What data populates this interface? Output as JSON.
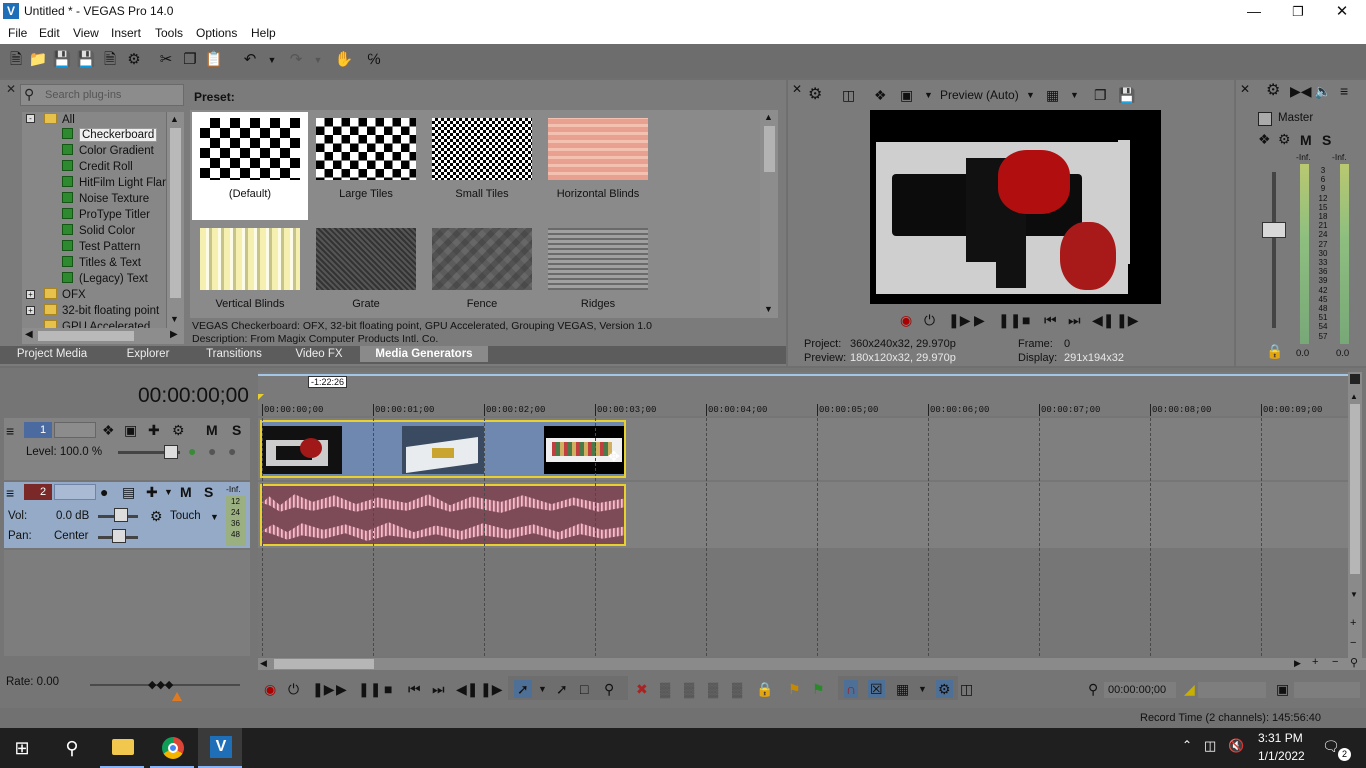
{
  "window": {
    "title": "Untitled * - VEGAS Pro 14.0"
  },
  "menu": [
    "File",
    "Edit",
    "View",
    "Insert",
    "Tools",
    "Options",
    "Help"
  ],
  "plugins": {
    "search_placeholder": "Search plug-ins",
    "tree": [
      {
        "label": "All",
        "type": "folder"
      },
      {
        "label": "Checkerboard",
        "type": "gen",
        "selected": true
      },
      {
        "label": "Color Gradient",
        "type": "gen"
      },
      {
        "label": "Credit Roll",
        "type": "gen"
      },
      {
        "label": "HitFilm Light Flares",
        "type": "gen"
      },
      {
        "label": "Noise Texture",
        "type": "gen"
      },
      {
        "label": "ProType Titler",
        "type": "gen"
      },
      {
        "label": "Solid Color",
        "type": "gen"
      },
      {
        "label": "Test Pattern",
        "type": "gen"
      },
      {
        "label": "Titles & Text",
        "type": "gen"
      },
      {
        "label": "(Legacy) Text",
        "type": "gen"
      },
      {
        "label": "OFX",
        "type": "folder"
      },
      {
        "label": "32-bit floating point",
        "type": "folder"
      },
      {
        "label": "GPU Accelerated",
        "type": "folder"
      }
    ],
    "preset_label": "Preset:",
    "presets": [
      "(Default)",
      "Large Tiles",
      "Small Tiles",
      "Horizontal Blinds",
      "Vertical Blinds",
      "Grate",
      "Fence",
      "Ridges"
    ],
    "info_line1": "VEGAS Checkerboard: OFX, 32-bit floating point, GPU Accelerated, Grouping VEGAS, Version 1.0",
    "info_line2": "Description: From Magix Computer Products Intl. Co.",
    "tabs": [
      "Project Media",
      "Explorer",
      "Transitions",
      "Video FX",
      "Media Generators"
    ]
  },
  "preview": {
    "mode": "Preview (Auto)",
    "project_label": "Project:",
    "project_value": "360x240x32, 29.970p",
    "preview_label": "Preview:",
    "preview_value": "180x120x32, 29.970p",
    "frame_label": "Frame:",
    "frame_value": "0",
    "display_label": "Display:",
    "display_value": "291x194x32"
  },
  "mixer": {
    "master_label": "Master",
    "m": "M",
    "s": "S",
    "inf_left": "-Inf.",
    "inf_right": "-Inf.",
    "scale": [
      "3",
      "6",
      "9",
      "12",
      "15",
      "18",
      "21",
      "24",
      "27",
      "30",
      "33",
      "36",
      "39",
      "42",
      "45",
      "48",
      "51",
      "54",
      "57"
    ],
    "bottom_left": "0.0",
    "bottom_right": "0.0"
  },
  "timeline": {
    "timecode": "00:00:00;00",
    "marker": "-1:22:26",
    "ruler": [
      "00:00:00;00",
      "00:00:01;00",
      "00:00:02;00",
      "00:00:03;00",
      "00:00:04;00",
      "00:00:05;00",
      "00:00:06;00",
      "00:00:07;00",
      "00:00:08;00",
      "00:00:09;00"
    ],
    "video_track": {
      "num": "1",
      "level": "Level: 100.0 %",
      "m": "M",
      "s": "S"
    },
    "audio_track": {
      "num": "2",
      "vol_label": "Vol:",
      "vol_value": "0.0 dB",
      "pan_label": "Pan:",
      "pan_value": "Center",
      "touch": "Touch",
      "m": "M",
      "s": "S",
      "inf": "-Inf.",
      "scale": [
        "12",
        "24",
        "36",
        "48"
      ]
    },
    "rate": "Rate: 0.00",
    "time_display": "00:00:00;00"
  },
  "status": {
    "record_time": "Record Time (2 channels): 145:56:40"
  },
  "taskbar": {
    "time": "3:31 PM",
    "date": "1/1/2022",
    "notif_count": "2"
  }
}
